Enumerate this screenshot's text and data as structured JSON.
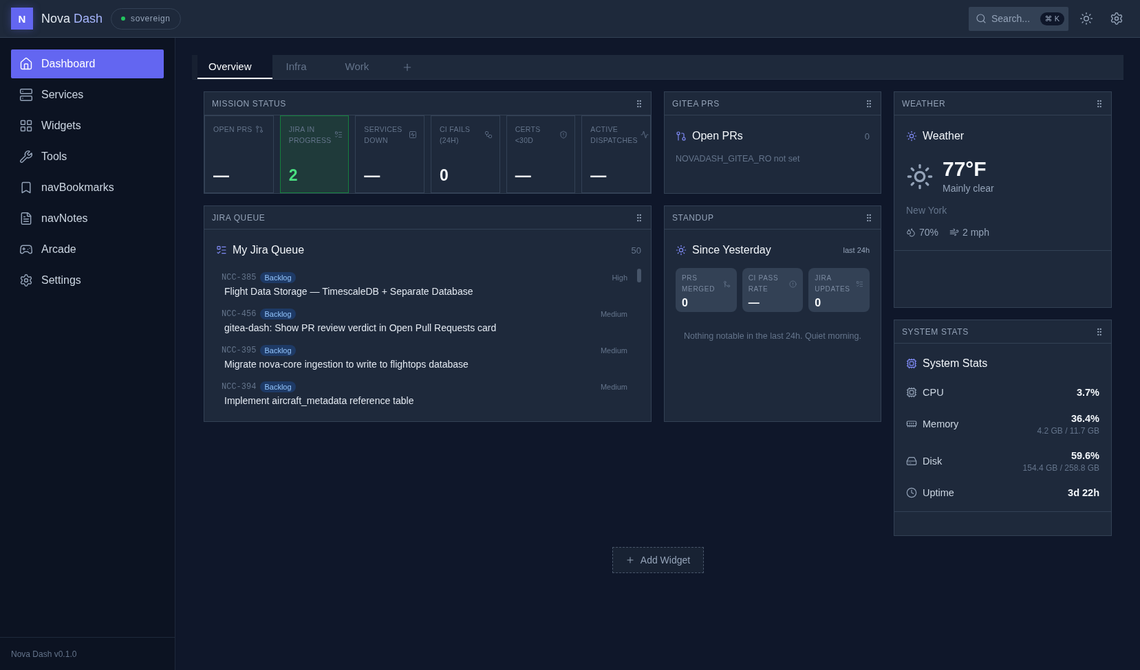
{
  "app": {
    "logo_letter": "N",
    "name": "Nova",
    "name_accent": "Dash",
    "environment": "sovereign"
  },
  "search": {
    "placeholder": "Search...",
    "shortcut": "⌘ K"
  },
  "sidebar": {
    "items": [
      {
        "label": "Dashboard",
        "selected": true
      },
      {
        "label": "Services",
        "selected": false
      },
      {
        "label": "Widgets",
        "selected": false
      },
      {
        "label": "Tools",
        "selected": false
      },
      {
        "label": "navBookmarks",
        "selected": false
      },
      {
        "label": "navNotes",
        "selected": false
      },
      {
        "label": "Arcade",
        "selected": false
      },
      {
        "label": "Settings",
        "selected": false
      }
    ],
    "version": "Nova Dash v0.1.0"
  },
  "tabs": [
    {
      "label": "Overview",
      "selected": true
    },
    {
      "label": "Infra",
      "selected": false
    },
    {
      "label": "Work",
      "selected": false
    }
  ],
  "widgets": {
    "mission_status": {
      "header": "MISSION STATUS",
      "tiles": [
        {
          "label": "OPEN PRS",
          "value": "—",
          "highlighted": false
        },
        {
          "label": "JIRA IN PROGRESS",
          "value": "2",
          "highlighted": true
        },
        {
          "label": "SERVICES DOWN",
          "value": "—",
          "highlighted": false
        },
        {
          "label": "CI FAILS (24H)",
          "value": "0",
          "highlighted": false
        },
        {
          "label": "CERTS <30D",
          "value": "—",
          "highlighted": false
        },
        {
          "label": "ACTIVE DISPATCHES",
          "value": "—",
          "highlighted": false
        }
      ]
    },
    "gitea_prs": {
      "header": "GITEA PRS",
      "title": "Open PRs",
      "count": "0",
      "message": "NOVADASH_GITEA_RO not set"
    },
    "weather": {
      "header": "WEATHER",
      "title": "Weather",
      "temperature": "77°F",
      "condition": "Mainly clear",
      "location": "New York",
      "humidity": "70%",
      "wind": "2 mph"
    },
    "jira_queue": {
      "header": "JIRA QUEUE",
      "title": "My Jira Queue",
      "count": "50",
      "issues": [
        {
          "key": "NCC-385",
          "status": "Backlog",
          "priority": "High",
          "title": "Flight Data Storage — TimescaleDB + Separate Database"
        },
        {
          "key": "NCC-456",
          "status": "Backlog",
          "priority": "Medium",
          "title": "gitea-dash: Show PR review verdict in Open Pull Requests card"
        },
        {
          "key": "NCC-395",
          "status": "Backlog",
          "priority": "Medium",
          "title": "Migrate nova-core ingestion to write to flightops database"
        },
        {
          "key": "NCC-394",
          "status": "Backlog",
          "priority": "Medium",
          "title": "Implement aircraft_metadata reference table"
        }
      ]
    },
    "standup": {
      "header": "STANDUP",
      "title": "Since Yesterday",
      "period": "last 24h",
      "stats": [
        {
          "label": "PRS MERGED",
          "value": "0"
        },
        {
          "label": "CI PASS RATE",
          "value": "—"
        },
        {
          "label": "JIRA UPDATES",
          "value": "0"
        }
      ],
      "message": "Nothing notable in the last 24h. Quiet morning."
    },
    "system_stats": {
      "header": "SYSTEM STATS",
      "title": "System Stats",
      "rows": [
        {
          "label": "CPU",
          "value": "3.7%"
        },
        {
          "label": "Memory",
          "value": "36.4%",
          "detail": "4.2 GB / 11.7 GB"
        },
        {
          "label": "Disk",
          "value": "59.6%",
          "detail": "154.4 GB / 258.8 GB"
        },
        {
          "label": "Uptime",
          "value": "3d 22h"
        }
      ]
    }
  },
  "add_widget": {
    "label": "Add Widget"
  }
}
